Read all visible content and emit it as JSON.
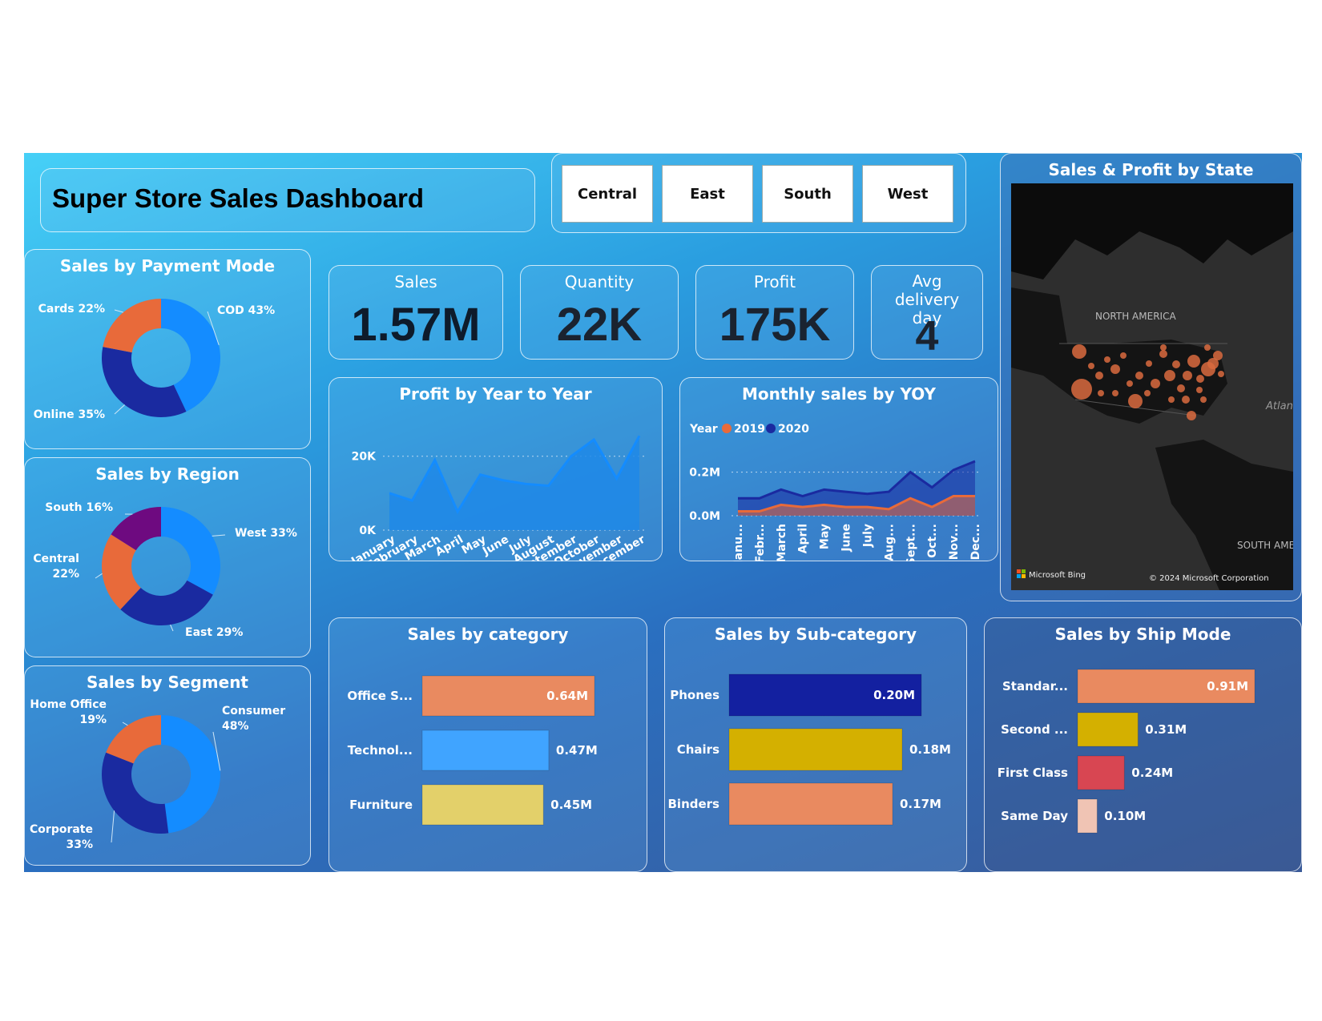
{
  "header": {
    "title": "Super Store Sales Dashboard"
  },
  "filters": {
    "regions": [
      "Central",
      "East",
      "South",
      "West"
    ]
  },
  "kpis": [
    {
      "label": "Sales",
      "value": "1.57M"
    },
    {
      "label": "Quantity",
      "value": "22K"
    },
    {
      "label": "Profit",
      "value": "175K"
    },
    {
      "label": "Avg delivery day",
      "value": "4"
    }
  ],
  "map": {
    "title": "Sales & Profit by State",
    "label_na": "NORTH AMERICA",
    "label_sa": "SOUTH AME",
    "label_atl": "Atlan",
    "bing": "Microsoft Bing",
    "copyright": "© 2024 Microsoft Corporation"
  },
  "colors": {
    "orange": "#e86a3a",
    "blue": "#148cff",
    "navy": "#1a2aa0",
    "purple": "#6e0a80",
    "salmon": "#e98a60",
    "lightblue": "#40a4ff",
    "yellow": "#e3d06a",
    "gold": "#d4b000",
    "red": "#d84652",
    "pink": "#f0c4b4"
  },
  "chart_data": [
    {
      "type": "pie",
      "title": "Sales by Payment Mode",
      "slices": [
        {
          "label": "COD 43%",
          "value": 43,
          "color": "#148cff"
        },
        {
          "label": "Online 35%",
          "value": 35,
          "color": "#1a2aa0"
        },
        {
          "label": "Cards 22%",
          "value": 22,
          "color": "#e86a3a"
        }
      ]
    },
    {
      "type": "pie",
      "title": "Sales by Region",
      "slices": [
        {
          "label": "West 33%",
          "value": 33,
          "color": "#148cff"
        },
        {
          "label": "East 29%",
          "value": 29,
          "color": "#1a2aa0"
        },
        {
          "label": "Central 22%",
          "value": 22,
          "color": "#e86a3a"
        },
        {
          "label": "South 16%",
          "value": 16,
          "color": "#6e0a80"
        }
      ]
    },
    {
      "type": "pie",
      "title": "Sales by Segment",
      "slices": [
        {
          "label": "Consumer 48%",
          "value": 48,
          "color": "#148cff"
        },
        {
          "label": "Corporate 33%",
          "value": 33,
          "color": "#1a2aa0"
        },
        {
          "label": "Home Office 19%",
          "value": 19,
          "color": "#e86a3a"
        }
      ]
    },
    {
      "type": "area",
      "title": "Profit by Year to Year",
      "categories": [
        "January",
        "February",
        "March",
        "April",
        "May",
        "June",
        "July",
        "August",
        "September",
        "October",
        "November",
        "December"
      ],
      "values": [
        10000,
        8000,
        19000,
        5000,
        15000,
        13500,
        12500,
        12000,
        20000,
        24500,
        14000,
        25500
      ],
      "yticks": [
        "0K",
        "20K"
      ],
      "ylim": [
        0,
        26000
      ]
    },
    {
      "type": "area",
      "title": "Monthly sales by YOY",
      "categories": [
        "Janu...",
        "Febr...",
        "March",
        "April",
        "May",
        "June",
        "July",
        "Aug...",
        "Sept...",
        "Oct...",
        "Nov...",
        "Dec..."
      ],
      "legend_title": "Year",
      "series": [
        {
          "name": "2019",
          "color": "#e86a3a",
          "values": [
            0.02,
            0.02,
            0.05,
            0.04,
            0.05,
            0.04,
            0.04,
            0.03,
            0.08,
            0.04,
            0.09,
            0.09
          ]
        },
        {
          "name": "2020",
          "color": "#1a2aa0",
          "values": [
            0.08,
            0.08,
            0.12,
            0.09,
            0.12,
            0.11,
            0.1,
            0.11,
            0.2,
            0.13,
            0.21,
            0.25
          ]
        }
      ],
      "yticks": [
        "0.0M",
        "0.2M"
      ],
      "ylim": [
        0,
        0.25
      ]
    },
    {
      "type": "bar",
      "title": "Sales by category",
      "categories": [
        "Office S...",
        "Technol...",
        "Furniture"
      ],
      "values": [
        0.64,
        0.47,
        0.45
      ],
      "labels": [
        "0.64M",
        "0.47M",
        "0.45M"
      ],
      "colors": [
        "#e98a60",
        "#40a4ff",
        "#e3d06a"
      ]
    },
    {
      "type": "bar",
      "title": "Sales by Sub-category",
      "categories": [
        "Phones",
        "Chairs",
        "Binders"
      ],
      "values": [
        0.2,
        0.18,
        0.17
      ],
      "labels": [
        "0.20M",
        "0.18M",
        "0.17M"
      ],
      "colors": [
        "#1320a0",
        "#d4b000",
        "#e98a60"
      ]
    },
    {
      "type": "bar",
      "title": "Sales by Ship Mode",
      "categories": [
        "Standar...",
        "Second ...",
        "First Class",
        "Same Day"
      ],
      "values": [
        0.91,
        0.31,
        0.24,
        0.1
      ],
      "labels": [
        "0.91M",
        "0.31M",
        "0.24M",
        "0.10M"
      ],
      "colors": [
        "#e98a60",
        "#d4b000",
        "#d84652",
        "#f0c4b4"
      ]
    }
  ]
}
